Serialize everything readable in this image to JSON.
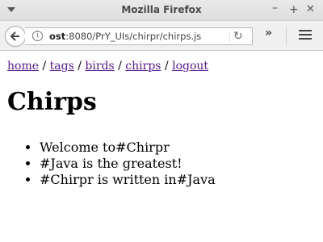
{
  "window": {
    "title": "Mozilla Firefox",
    "minimize_label": "–",
    "maximize_label": "+",
    "close_label": "✕"
  },
  "navbar": {
    "url_host": "ost",
    "url_rest": ":8080/PrY_UIs/chirpr/chirps.js",
    "info_icon": "info-icon",
    "reload_icon": "reload-icon",
    "overflow_label": "»"
  },
  "page": {
    "links": [
      {
        "label": "home"
      },
      {
        "label": "tags"
      },
      {
        "label": "birds"
      },
      {
        "label": "chirps"
      },
      {
        "label": "logout"
      }
    ],
    "separator": " / ",
    "heading": "Chirps",
    "chirps": [
      "Welcome to#Chirpr",
      "#Java is the greatest!",
      "#Chirpr is written in#Java"
    ]
  }
}
